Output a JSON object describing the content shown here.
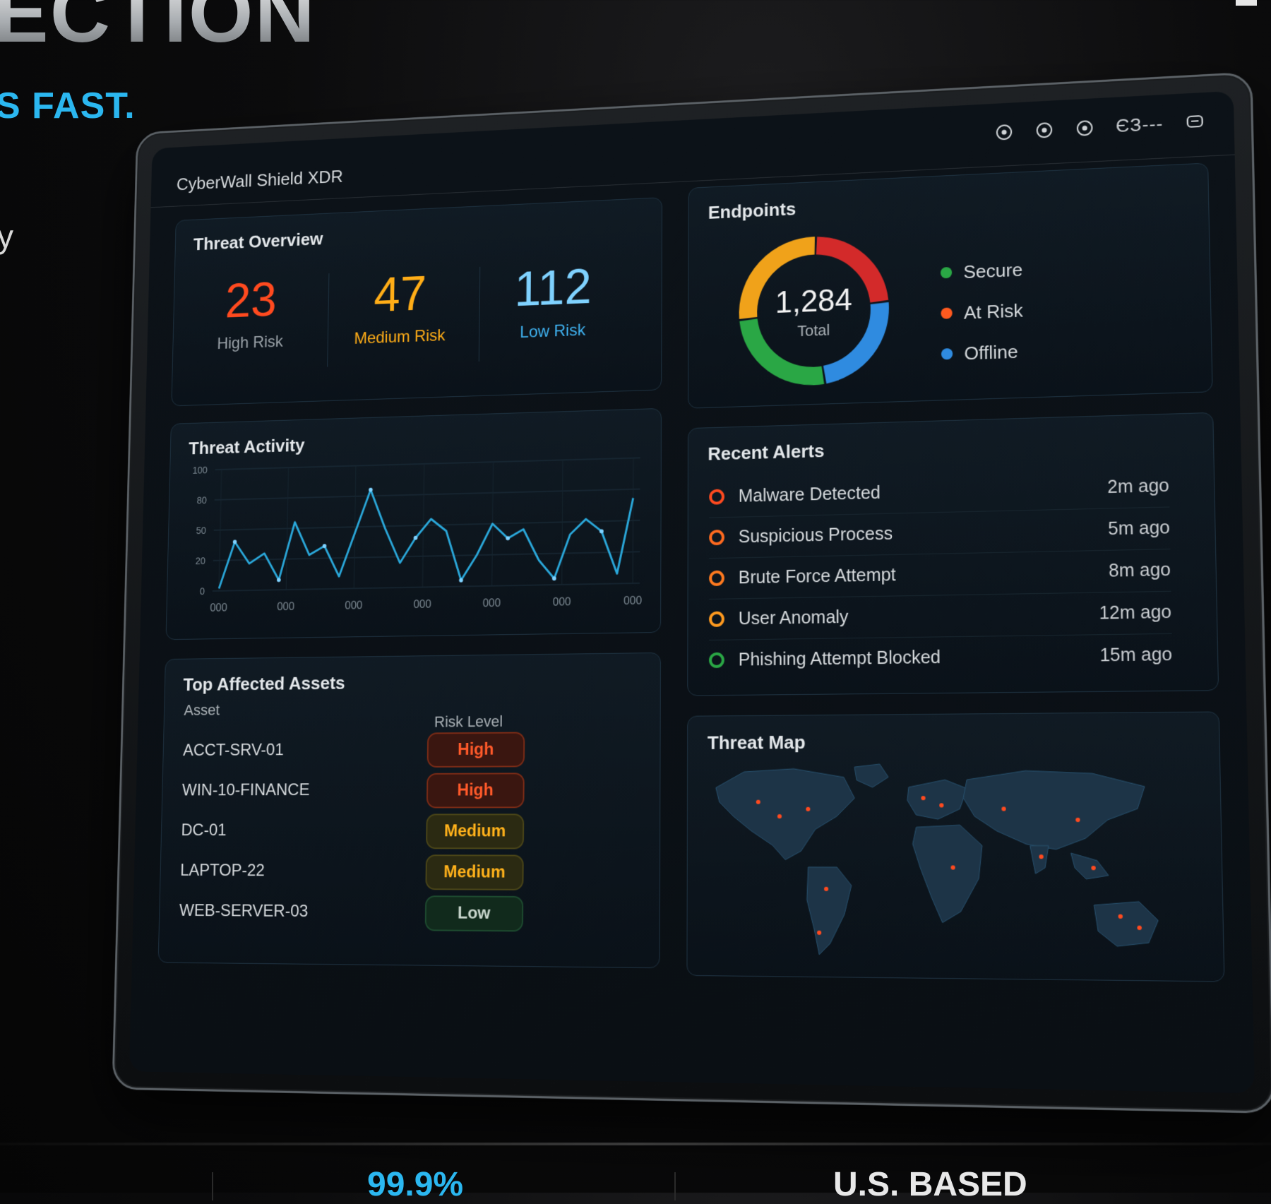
{
  "hero": {
    "title": "ECTION",
    "subtitle": "S FAST.",
    "fragment": "y"
  },
  "app": {
    "title": "CyberWall Shield XDR",
    "top_icon_text": "ЄЗ---"
  },
  "overview": {
    "title": "Threat Overview",
    "high": {
      "value": "23",
      "label": "High Risk"
    },
    "medium": {
      "value": "47",
      "label": "Medium Risk"
    },
    "low": {
      "value": "112",
      "label": "Low Risk"
    }
  },
  "endpoints": {
    "title": "Endpoints",
    "total": "1,284",
    "total_label": "Total",
    "legend": [
      {
        "label": "Secure",
        "color": "#2aa745"
      },
      {
        "label": "At Risk",
        "color": "#ff5a1f"
      },
      {
        "label": "Offline",
        "color": "#2f8be0"
      }
    ],
    "segments": [
      {
        "color": "#d32a2a",
        "fraction": 0.23
      },
      {
        "color": "#2f8be0",
        "fraction": 0.24
      },
      {
        "color": "#2aa745",
        "fraction": 0.26
      },
      {
        "color": "#f0a21a",
        "fraction": 0.27
      }
    ]
  },
  "activity": {
    "title": "Threat Activity"
  },
  "chart_data": {
    "type": "line",
    "title": "Threat Activity",
    "xlabel": "",
    "ylabel": "",
    "y_ticks": [
      "0",
      "20",
      "50",
      "80",
      "100"
    ],
    "x_ticks": [
      "000",
      "000",
      "000",
      "000",
      "000",
      "000",
      "000"
    ],
    "ylim": [
      0,
      100
    ],
    "series": [
      {
        "values": [
          2,
          40,
          22,
          30,
          8,
          55,
          28,
          35,
          10,
          45,
          80,
          48,
          20,
          40,
          55,
          45,
          5,
          25,
          50,
          38,
          45,
          20,
          5,
          40,
          52,
          42,
          8,
          68
        ]
      }
    ]
  },
  "alerts": {
    "title": "Recent Alerts",
    "items": [
      {
        "text": "Malware Detected",
        "time": "2m ago",
        "color": "#ff4a1f"
      },
      {
        "text": "Suspicious Process",
        "time": "5m ago",
        "color": "#ff6a1f"
      },
      {
        "text": "Brute Force Attempt",
        "time": "8m ago",
        "color": "#ff7a1f"
      },
      {
        "text": "User Anomaly",
        "time": "12m ago",
        "color": "#ff9a1f"
      },
      {
        "text": "Phishing Attempt Blocked",
        "time": "15m ago",
        "color": "#2aa745"
      }
    ]
  },
  "assets": {
    "title": "Top Affected Assets",
    "col_asset": "Asset",
    "col_risk": "Risk Level",
    "rows": [
      {
        "name": "ACCT-SRV-01",
        "risk": "High",
        "level": "high"
      },
      {
        "name": "WIN-10-FINANCE",
        "risk": "High",
        "level": "high"
      },
      {
        "name": "DC-01",
        "risk": "Medium",
        "level": "medium"
      },
      {
        "name": "LAPTOP-22",
        "risk": "Medium",
        "level": "medium"
      },
      {
        "name": "WEB-SERVER-03",
        "risk": "Low",
        "level": "low"
      }
    ]
  },
  "map": {
    "title": "Threat Map"
  },
  "bottom": {
    "item1": "99.9%",
    "item2": "U.S. BASED"
  }
}
